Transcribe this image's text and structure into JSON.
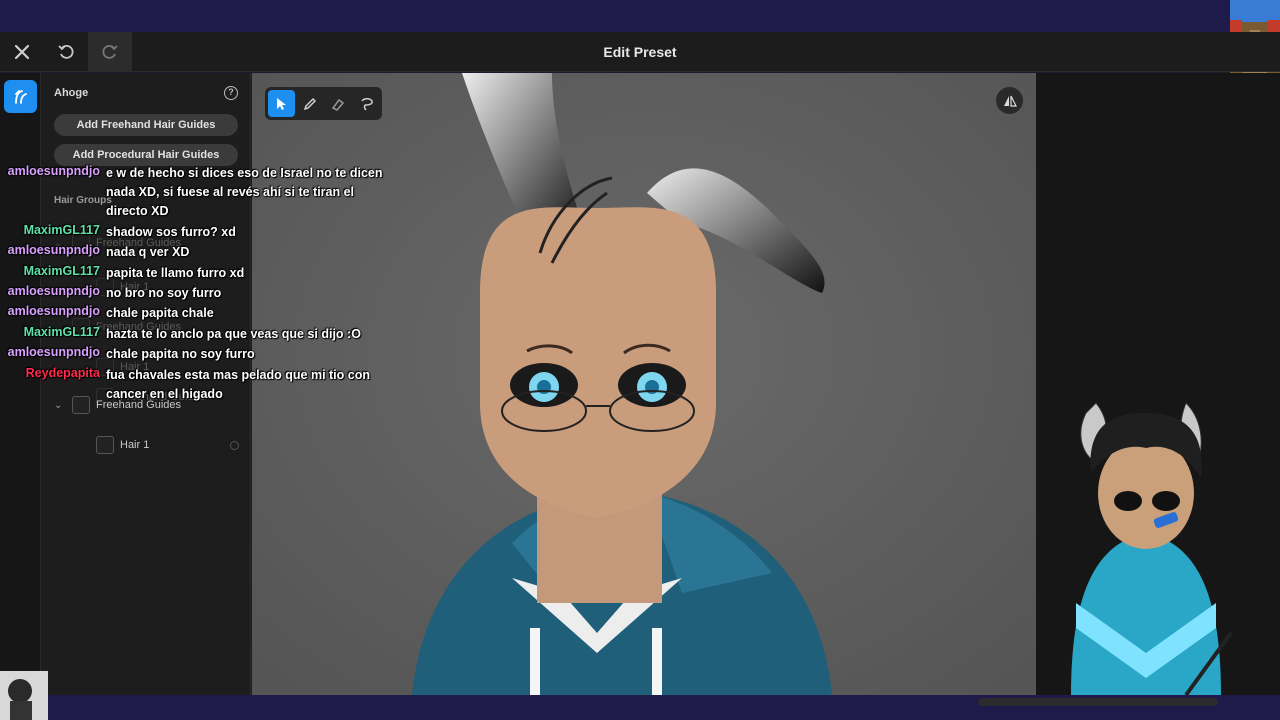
{
  "window": {
    "title": "Edit Preset",
    "close_label": "×"
  },
  "panel": {
    "section_title": "Ahoge",
    "add_freehand_label": "Add Freehand Hair Guides",
    "add_procedural_label": "Add Procedural Hair Guides",
    "hair_groups_label": "Hair Groups",
    "tree": [
      {
        "label": "Freehand Guides",
        "level": 0
      },
      {
        "label": "Hair 1",
        "level": 1
      }
    ],
    "ghost_rows": [
      "Freehand Guides",
      "Hair 1",
      "Freehand Guides",
      "Hair 1",
      "Freehand Guides"
    ]
  },
  "chat": [
    {
      "user": "amloesunpndjo",
      "color": "#d9a0ff",
      "text": "e w de hecho si dices eso de Israel no te dicen nada XD, si fuese al revés ahí si te tiran el directo XD"
    },
    {
      "user": "MaximGL117",
      "color": "#5fe0a8",
      "text": "shadow sos furro? xd"
    },
    {
      "user": "amloesunpndjo",
      "color": "#d9a0ff",
      "text": "nada q ver XD"
    },
    {
      "user": "MaximGL117",
      "color": "#5fe0a8",
      "text": "papita te llamo furro xd"
    },
    {
      "user": "amloesunpndjo",
      "color": "#d9a0ff",
      "text": "no bro no soy furro"
    },
    {
      "user": "amloesunpndjo",
      "color": "#d9a0ff",
      "text": "chale papita chale"
    },
    {
      "user": "MaximGL117",
      "color": "#5fe0a8",
      "text": "hazta te lo anclo pa que veas que si dijo :O"
    },
    {
      "user": "amloesunpndjo",
      "color": "#d9a0ff",
      "text": "chale papita no soy furro"
    },
    {
      "user": "Reydepapita",
      "color": "#ff2a4a",
      "text": "fua chavales esta mas pelado que mi tio con cancer en el higado"
    }
  ],
  "icons": {
    "close": "close-icon",
    "undo": "undo-icon",
    "redo": "redo-icon",
    "hair_tool": "hair-tool-icon",
    "help": "help-icon",
    "select": "cursor-icon",
    "pen": "pen-icon",
    "eraser": "eraser-icon",
    "lasso": "lasso-icon",
    "mirror": "mirror-icon"
  },
  "colors": {
    "accent": "#1e8ff0",
    "viewport_bg": "#606060",
    "panel_bg": "#1d1d1d",
    "stream_frame": "#1e1a4a"
  }
}
